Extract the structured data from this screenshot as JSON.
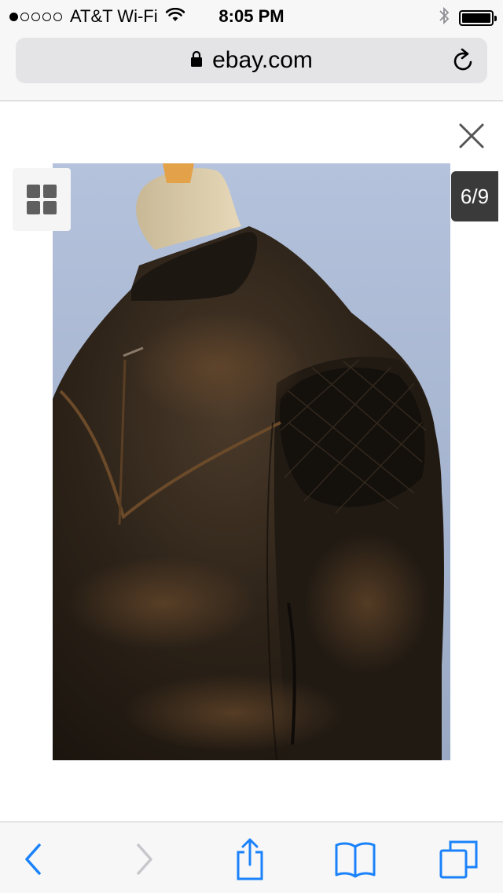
{
  "status_bar": {
    "carrier": "AT&T Wi-Fi",
    "time": "8:05 PM",
    "signal_bars_filled": 1,
    "signal_bars_total": 5,
    "battery_level": 1.0
  },
  "address_bar": {
    "url": "ebay.com",
    "secure": true
  },
  "gallery": {
    "counter": "6/9",
    "image_subject": "leather-jacket-on-mannequin"
  },
  "colors": {
    "ios_blue": "#1a82fb",
    "disabled_gray": "#c7c7cc"
  }
}
